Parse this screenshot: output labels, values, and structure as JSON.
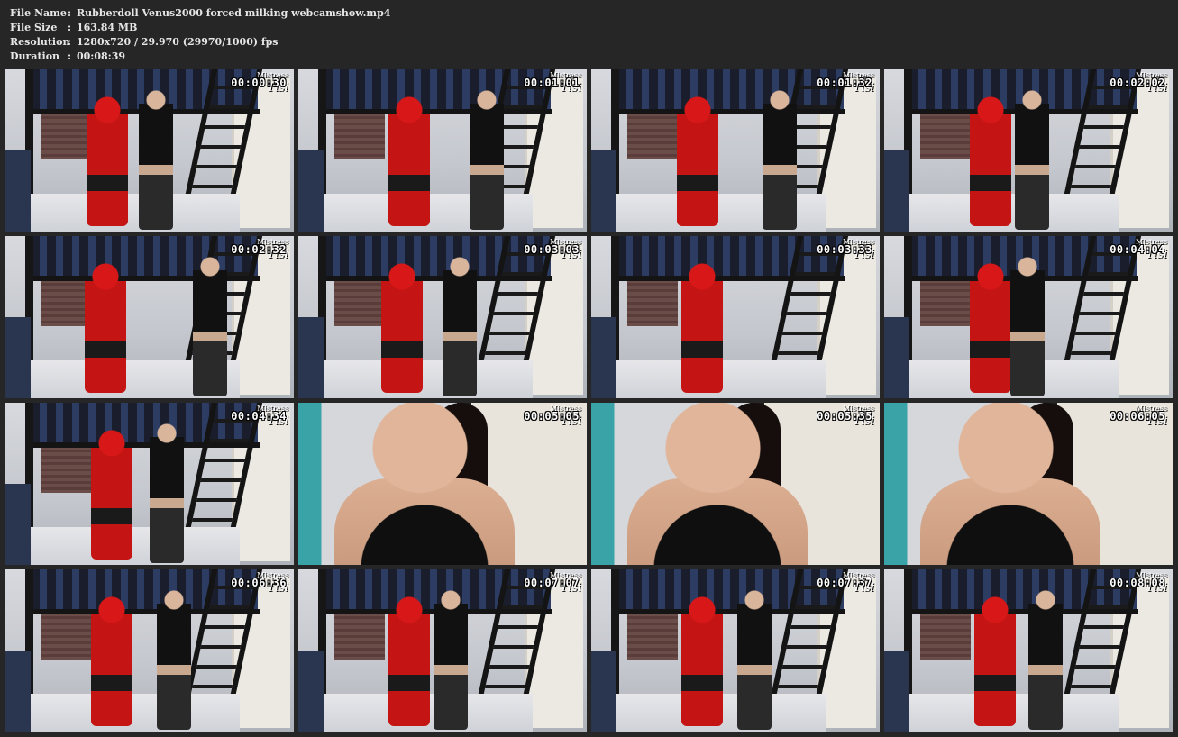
{
  "info": {
    "rows": [
      {
        "label": "File Name",
        "sep": ":",
        "value": "Rubberdoll Venus2000 forced milking webcamshow.mp4"
      },
      {
        "label": "File Size",
        "sep": ":",
        "value": "163.84 MB"
      },
      {
        "label": "Resolution",
        "sep": ":",
        "value": "1280x720 / 29.970 (29970/1000) fps"
      },
      {
        "label": "Duration",
        "sep": ":",
        "value": "00:08:39"
      }
    ]
  },
  "watermark": {
    "line1": "Mistress",
    "line2": "Tisi"
  },
  "thumbnails": [
    {
      "timestamp": "00:00:30",
      "scene": "room"
    },
    {
      "timestamp": "00:01:01",
      "scene": "room"
    },
    {
      "timestamp": "00:01:32",
      "scene": "room"
    },
    {
      "timestamp": "00:02:02",
      "scene": "room"
    },
    {
      "timestamp": "00:02:32",
      "scene": "room"
    },
    {
      "timestamp": "00:03:03",
      "scene": "room"
    },
    {
      "timestamp": "00:03:33",
      "scene": "room"
    },
    {
      "timestamp": "00:04:04",
      "scene": "room"
    },
    {
      "timestamp": "00:04:34",
      "scene": "room"
    },
    {
      "timestamp": "00:05:05",
      "scene": "closeup"
    },
    {
      "timestamp": "00:05:35",
      "scene": "closeup"
    },
    {
      "timestamp": "00:06:05",
      "scene": "closeup"
    },
    {
      "timestamp": "00:06:36",
      "scene": "room"
    },
    {
      "timestamp": "00:07:07",
      "scene": "room"
    },
    {
      "timestamp": "00:07:37",
      "scene": "room"
    },
    {
      "timestamp": "00:08:08",
      "scene": "room"
    }
  ]
}
